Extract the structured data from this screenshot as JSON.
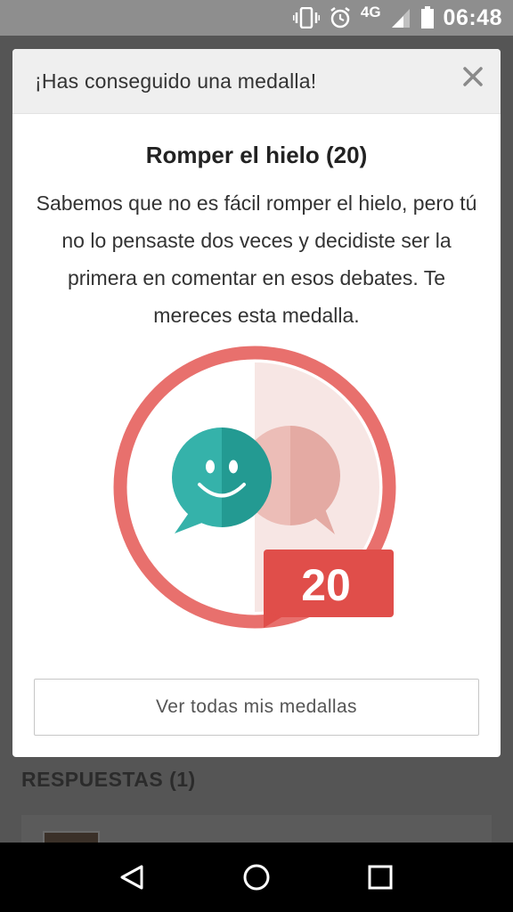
{
  "status_bar": {
    "network": "4G",
    "time": "06:48",
    "icons": [
      "vibrate-icon",
      "alarm-icon",
      "signal-icon",
      "battery-icon"
    ]
  },
  "background_page": {
    "section_title": "RESPUESTAS (1)"
  },
  "modal": {
    "title": "¡Has conseguido una medalla!",
    "close_icon": "close-icon",
    "medal_name": "Romper el hielo (20)",
    "description": "Sabemos que no es fácil romper el hielo, pero tú no lo pensaste dos veces y decidiste ser la primera en comentar en esos debates. Te mereces esta medalla.",
    "badge": {
      "icon": "chat-bubbles-medal-icon",
      "count": "20",
      "colors": {
        "ring": "#e8706d",
        "teal": "#2fa79f",
        "pink": "#e9b4ae",
        "label": "#e04e4a"
      }
    },
    "view_all_label": "Ver todas mis medallas"
  },
  "nav_bar": {
    "icons": [
      "back-icon",
      "home-icon",
      "recents-icon"
    ]
  }
}
